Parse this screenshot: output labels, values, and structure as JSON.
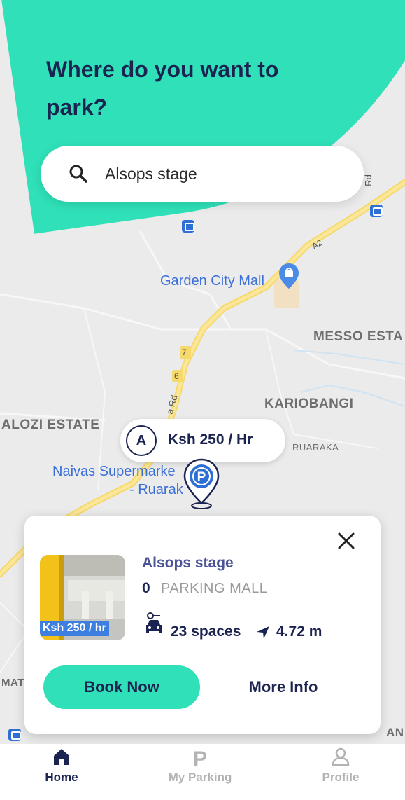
{
  "header": {
    "title": "Where do you want to park?"
  },
  "search": {
    "value": "Alsops stage",
    "icon": "search-icon"
  },
  "map": {
    "labels": {
      "garden_city": "Garden City Mall",
      "messo": "MESSO ESTA",
      "kariobangi": "KARIOBANGI",
      "alozi": "ALOZI ESTATE",
      "ruaraka": "RUARAKA",
      "naivas_line1": "Naivas Supermarke",
      "naivas_line2": "- Ruarak",
      "road_a2": "A2",
      "road_7": "7",
      "road_6": "6",
      "road_name": "a Rd",
      "edge_mat": "MAT",
      "edge_an": "AN",
      "edge_rd": "Rd"
    },
    "price_pill": {
      "badge": "A",
      "text": "Ksh 250 / Hr"
    }
  },
  "card": {
    "name": "Alsops stage",
    "count": "0",
    "type": "PARKING MALL",
    "thumb_price": "Ksh 250 / hr",
    "spaces": "23 spaces",
    "distance": "4.72 m",
    "book_label": "Book Now",
    "more_label": "More Info"
  },
  "bottom_nav": {
    "items": [
      {
        "label": "Home",
        "icon": "home-icon",
        "active": true
      },
      {
        "label": "My Parking",
        "icon": "parking-icon",
        "active": false
      },
      {
        "label": "Profile",
        "icon": "profile-icon",
        "active": false
      }
    ]
  },
  "colors": {
    "accent": "#2fe0b8",
    "navy": "#1b2350",
    "map_bg": "#ebebeb",
    "road": "#f5d96b",
    "link_blue": "#3b6fd8"
  }
}
